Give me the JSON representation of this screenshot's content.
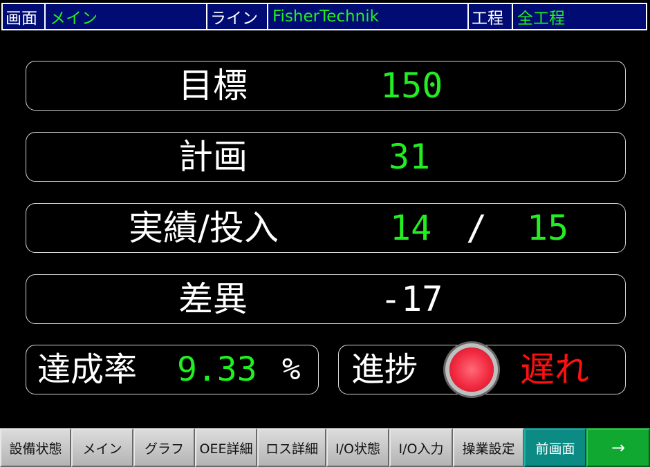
{
  "header": {
    "screen_label": "画面",
    "screen_value": "メイン",
    "line_label": "ライン",
    "line_value": "FisherTechnik",
    "process_label": "工程",
    "process_value": "全工程"
  },
  "target": {
    "label": "目標",
    "value": "150"
  },
  "plan": {
    "label": "計画",
    "value": "31"
  },
  "actual": {
    "label": "実績/投入",
    "actual_value": "14",
    "separator": "/",
    "input_value": "15"
  },
  "difference": {
    "label": "差異",
    "value": "-17"
  },
  "achievement": {
    "label": "達成率",
    "value": "9.33",
    "unit": "%"
  },
  "progress": {
    "label": "進捗",
    "lamp_color": "#f22a40",
    "status": "遅れ",
    "status_color": "#ff1010"
  },
  "colors": {
    "header_bg": "#000c73",
    "value_green": "#22ee22",
    "accent_teal": "#0c8a84",
    "accent_green": "#10a830"
  },
  "nav": {
    "equipment_status": "設備状態",
    "main": "メイン",
    "graph": "グラフ",
    "oee_detail": "OEE詳細",
    "loss_detail": "ロス詳細",
    "io_status": "I/O状態",
    "io_input": "I/O入力",
    "operation_settings": "操業設定",
    "previous_screen": "前画面",
    "next": "→"
  }
}
